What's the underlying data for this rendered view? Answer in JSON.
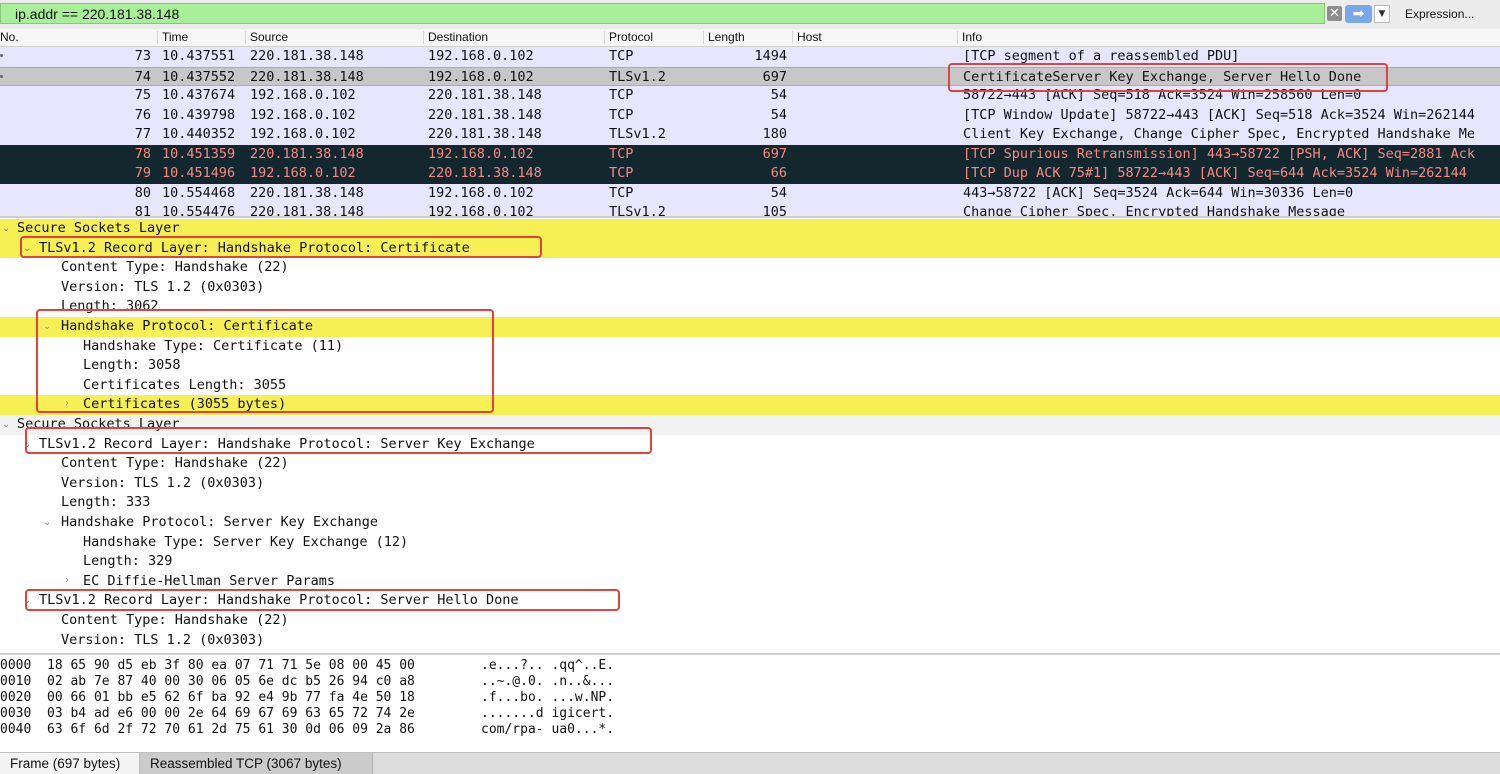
{
  "filter": {
    "value": "ip.addr == 220.181.38.148",
    "clear_icon": "clear-filter-icon",
    "apply_icon": "apply-arrow-icon",
    "expression_label": "Expression..."
  },
  "columns": [
    "No.",
    "Time",
    "Source",
    "Destination",
    "Protocol",
    "Length",
    "Host",
    "Info"
  ],
  "packets": [
    {
      "no": "73",
      "time": "10.437551",
      "src": "220.181.38.148",
      "dst": "192.168.0.102",
      "proto": "TCP",
      "len": "1494",
      "info": "[TCP segment of a reassembled PDU]"
    },
    {
      "no": "74",
      "time": "10.437552",
      "src": "220.181.38.148",
      "dst": "192.168.0.102",
      "proto": "TLSv1.2",
      "len": "697",
      "info": "CertificateServer Key Exchange, Server Hello Done"
    },
    {
      "no": "75",
      "time": "10.437674",
      "src": "192.168.0.102",
      "dst": "220.181.38.148",
      "proto": "TCP",
      "len": "54",
      "info": "58722→443 [ACK] Seq=518 Ack=3524 Win=258560 Len=0"
    },
    {
      "no": "76",
      "time": "10.439798",
      "src": "192.168.0.102",
      "dst": "220.181.38.148",
      "proto": "TCP",
      "len": "54",
      "info": "[TCP Window Update] 58722→443 [ACK] Seq=518 Ack=3524 Win=262144"
    },
    {
      "no": "77",
      "time": "10.440352",
      "src": "192.168.0.102",
      "dst": "220.181.38.148",
      "proto": "TLSv1.2",
      "len": "180",
      "info": "Client Key Exchange, Change Cipher Spec, Encrypted Handshake Me"
    },
    {
      "no": "78",
      "time": "10.451359",
      "src": "220.181.38.148",
      "dst": "192.168.0.102",
      "proto": "TCP",
      "len": "697",
      "info": "[TCP Spurious Retransmission] 443→58722 [PSH, ACK] Seq=2881 Ack"
    },
    {
      "no": "79",
      "time": "10.451496",
      "src": "192.168.0.102",
      "dst": "220.181.38.148",
      "proto": "TCP",
      "len": "66",
      "info": "[TCP Dup ACK 75#1] 58722→443 [ACK] Seq=644 Ack=3524 Win=262144"
    },
    {
      "no": "80",
      "time": "10.554468",
      "src": "220.181.38.148",
      "dst": "192.168.0.102",
      "proto": "TCP",
      "len": "54",
      "info": "443→58722 [ACK] Seq=3524 Ack=644 Win=30336 Len=0"
    },
    {
      "no": "81",
      "time": "10.554476",
      "src": "220.181.38.148",
      "dst": "192.168.0.102",
      "proto": "TLSv1.2",
      "len": "105",
      "info": "Change Cipher Spec, Encrypted Handshake Message"
    }
  ],
  "details": [
    {
      "text": "Secure Sockets Layer",
      "toggle": "⌄"
    },
    {
      "text": "TLSv1.2 Record Layer: Handshake Protocol: Certificate",
      "toggle": "⌄"
    },
    {
      "text": "Content Type: Handshake (22)",
      "toggle": ""
    },
    {
      "text": "Version: TLS 1.2 (0x0303)",
      "toggle": ""
    },
    {
      "text": "Length: 3062",
      "toggle": ""
    },
    {
      "text": "Handshake Protocol: Certificate",
      "toggle": "⌄"
    },
    {
      "text": "Handshake Type: Certificate (11)",
      "toggle": ""
    },
    {
      "text": "Length: 3058",
      "toggle": ""
    },
    {
      "text": "Certificates Length: 3055",
      "toggle": ""
    },
    {
      "text": "Certificates (3055 bytes)",
      "toggle": "›"
    },
    {
      "text": "Secure Sockets Layer",
      "toggle": "⌄"
    },
    {
      "text": "TLSv1.2 Record Layer: Handshake Protocol: Server Key Exchange",
      "toggle": "⌄"
    },
    {
      "text": "Content Type: Handshake (22)",
      "toggle": ""
    },
    {
      "text": "Version: TLS 1.2 (0x0303)",
      "toggle": ""
    },
    {
      "text": "Length: 333",
      "toggle": ""
    },
    {
      "text": "Handshake Protocol: Server Key Exchange",
      "toggle": "⌄"
    },
    {
      "text": "Handshake Type: Server Key Exchange (12)",
      "toggle": ""
    },
    {
      "text": "Length: 329",
      "toggle": ""
    },
    {
      "text": "EC Diffie-Hellman Server Params",
      "toggle": "›"
    },
    {
      "text": "TLSv1.2 Record Layer: Handshake Protocol: Server Hello Done",
      "toggle": "⌄"
    },
    {
      "text": "Content Type: Handshake (22)",
      "toggle": ""
    },
    {
      "text": "Version: TLS 1.2 (0x0303)",
      "toggle": ""
    }
  ],
  "hex": [
    {
      "off": "0000",
      "bytes": "18 65 90 d5 eb 3f 80 ea  07 71 71 5e 08 00 45 00",
      "ascii": ".e...?.. .qq^..E."
    },
    {
      "off": "0010",
      "bytes": "02 ab 7e 87 40 00 30 06  05 6e dc b5 26 94 c0 a8",
      "ascii": "..~.@.0. .n..&..."
    },
    {
      "off": "0020",
      "bytes": "00 66 01 bb e5 62 6f ba  92 e4 9b 77 fa 4e 50 18",
      "ascii": ".f...bo. ...w.NP."
    },
    {
      "off": "0030",
      "bytes": "03 b4 ad e6 00 00 2e 64  69 67 69 63 65 72 74 2e",
      "ascii": ".......d igicert."
    },
    {
      "off": "0040",
      "bytes": "63 6f 6d 2f 72 70 61 2d  75 61 30 0d 06 09 2a 86",
      "ascii": "com/rpa- ua0...*."
    }
  ],
  "status": {
    "frame_tab": "Frame (697 bytes)",
    "reassembled_tab": "Reassembled TCP (3067 bytes)"
  },
  "colors": {
    "filter_valid": "#a9ef99",
    "highlight": "#f7f055",
    "annotation": "#e0443c",
    "row_default": "#e7e6ff",
    "row_bad_bg": "#12272e",
    "row_bad_fg": "#f78a80"
  }
}
